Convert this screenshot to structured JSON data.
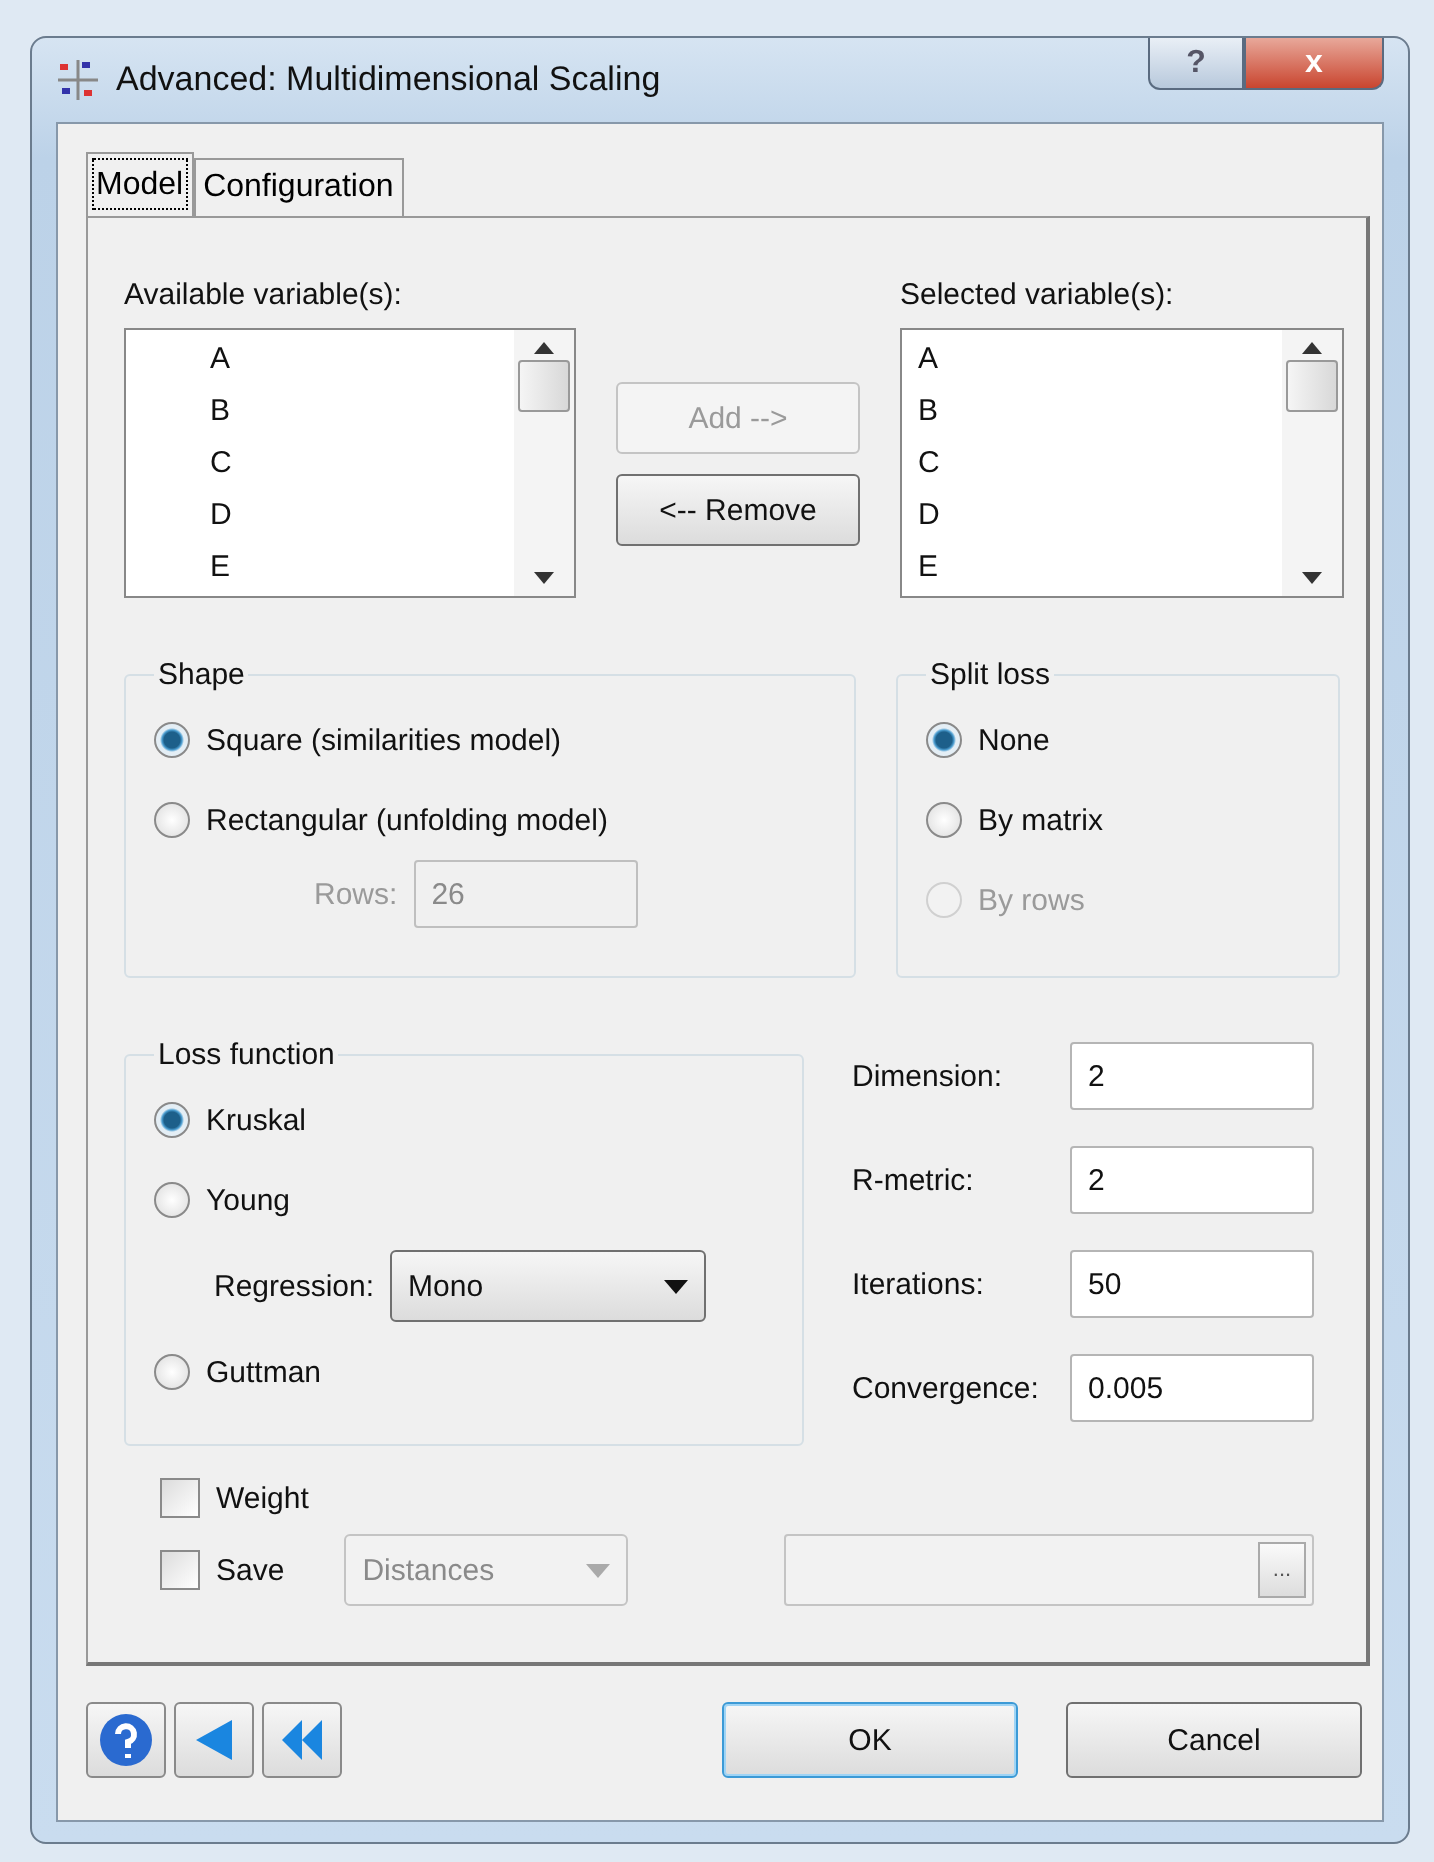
{
  "window": {
    "title": "Advanced: Multidimensional Scaling",
    "help_button": "?",
    "close_button": "x"
  },
  "tabs": [
    {
      "label": "Model",
      "selected": true
    },
    {
      "label": "Configuration",
      "selected": false
    }
  ],
  "available": {
    "label": "Available variable(s):",
    "items": [
      "A",
      "B",
      "C",
      "D",
      "E"
    ]
  },
  "selected_vars": {
    "label": "Selected variable(s):",
    "items": [
      "A",
      "B",
      "C",
      "D",
      "E"
    ]
  },
  "move_buttons": [
    {
      "label": "Add -->",
      "disabled": true
    },
    {
      "label": "<-- Remove",
      "disabled": false
    }
  ],
  "shape": {
    "title": "Shape",
    "options": [
      {
        "label": "Square (similarities model)",
        "selected": true,
        "disabled": false
      },
      {
        "label": "Rectangular (unfolding model)",
        "selected": false,
        "disabled": false
      }
    ],
    "rows": {
      "label": "Rows:",
      "value": "26",
      "disabled": true
    }
  },
  "split_loss": {
    "title": "Split loss",
    "options": [
      {
        "label": "None",
        "selected": true,
        "disabled": false
      },
      {
        "label": "By matrix",
        "selected": false,
        "disabled": false
      },
      {
        "label": "By rows",
        "selected": false,
        "disabled": true
      }
    ]
  },
  "loss_function": {
    "title": "Loss function",
    "options": [
      {
        "label": "Kruskal",
        "selected": true
      },
      {
        "label": "Young",
        "selected": false
      },
      {
        "label": "Guttman",
        "selected": false
      }
    ],
    "regression": {
      "label": "Regression:",
      "value": "Mono"
    }
  },
  "parameters": [
    {
      "label": "Dimension:",
      "value": "2"
    },
    {
      "label": "R-metric:",
      "value": "2"
    },
    {
      "label": "Iterations:",
      "value": "50"
    },
    {
      "label": "Convergence:",
      "value": "0.005"
    }
  ],
  "weight": {
    "label": "Weight",
    "checked": false
  },
  "save": {
    "label": "Save",
    "checked": false,
    "dropdown": "Distances",
    "browse": "..."
  },
  "footer": {
    "ok": "OK",
    "cancel": "Cancel"
  }
}
